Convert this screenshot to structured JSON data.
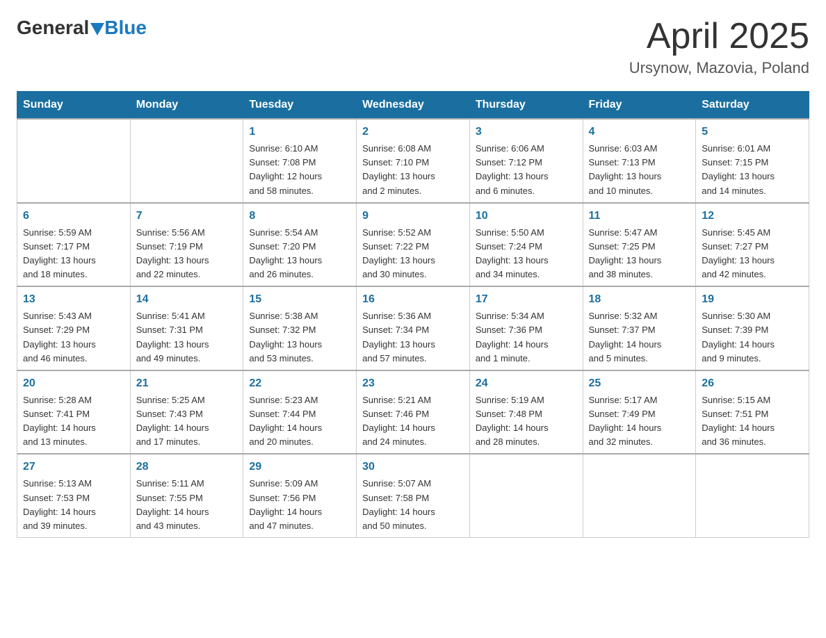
{
  "header": {
    "logo": {
      "general": "General",
      "blue": "Blue"
    },
    "title": "April 2025",
    "location": "Ursynow, Mazovia, Poland"
  },
  "weekdays": [
    "Sunday",
    "Monday",
    "Tuesday",
    "Wednesday",
    "Thursday",
    "Friday",
    "Saturday"
  ],
  "weeks": [
    [
      {
        "day": "",
        "info": ""
      },
      {
        "day": "",
        "info": ""
      },
      {
        "day": "1",
        "info": "Sunrise: 6:10 AM\nSunset: 7:08 PM\nDaylight: 12 hours\nand 58 minutes."
      },
      {
        "day": "2",
        "info": "Sunrise: 6:08 AM\nSunset: 7:10 PM\nDaylight: 13 hours\nand 2 minutes."
      },
      {
        "day": "3",
        "info": "Sunrise: 6:06 AM\nSunset: 7:12 PM\nDaylight: 13 hours\nand 6 minutes."
      },
      {
        "day": "4",
        "info": "Sunrise: 6:03 AM\nSunset: 7:13 PM\nDaylight: 13 hours\nand 10 minutes."
      },
      {
        "day": "5",
        "info": "Sunrise: 6:01 AM\nSunset: 7:15 PM\nDaylight: 13 hours\nand 14 minutes."
      }
    ],
    [
      {
        "day": "6",
        "info": "Sunrise: 5:59 AM\nSunset: 7:17 PM\nDaylight: 13 hours\nand 18 minutes."
      },
      {
        "day": "7",
        "info": "Sunrise: 5:56 AM\nSunset: 7:19 PM\nDaylight: 13 hours\nand 22 minutes."
      },
      {
        "day": "8",
        "info": "Sunrise: 5:54 AM\nSunset: 7:20 PM\nDaylight: 13 hours\nand 26 minutes."
      },
      {
        "day": "9",
        "info": "Sunrise: 5:52 AM\nSunset: 7:22 PM\nDaylight: 13 hours\nand 30 minutes."
      },
      {
        "day": "10",
        "info": "Sunrise: 5:50 AM\nSunset: 7:24 PM\nDaylight: 13 hours\nand 34 minutes."
      },
      {
        "day": "11",
        "info": "Sunrise: 5:47 AM\nSunset: 7:25 PM\nDaylight: 13 hours\nand 38 minutes."
      },
      {
        "day": "12",
        "info": "Sunrise: 5:45 AM\nSunset: 7:27 PM\nDaylight: 13 hours\nand 42 minutes."
      }
    ],
    [
      {
        "day": "13",
        "info": "Sunrise: 5:43 AM\nSunset: 7:29 PM\nDaylight: 13 hours\nand 46 minutes."
      },
      {
        "day": "14",
        "info": "Sunrise: 5:41 AM\nSunset: 7:31 PM\nDaylight: 13 hours\nand 49 minutes."
      },
      {
        "day": "15",
        "info": "Sunrise: 5:38 AM\nSunset: 7:32 PM\nDaylight: 13 hours\nand 53 minutes."
      },
      {
        "day": "16",
        "info": "Sunrise: 5:36 AM\nSunset: 7:34 PM\nDaylight: 13 hours\nand 57 minutes."
      },
      {
        "day": "17",
        "info": "Sunrise: 5:34 AM\nSunset: 7:36 PM\nDaylight: 14 hours\nand 1 minute."
      },
      {
        "day": "18",
        "info": "Sunrise: 5:32 AM\nSunset: 7:37 PM\nDaylight: 14 hours\nand 5 minutes."
      },
      {
        "day": "19",
        "info": "Sunrise: 5:30 AM\nSunset: 7:39 PM\nDaylight: 14 hours\nand 9 minutes."
      }
    ],
    [
      {
        "day": "20",
        "info": "Sunrise: 5:28 AM\nSunset: 7:41 PM\nDaylight: 14 hours\nand 13 minutes."
      },
      {
        "day": "21",
        "info": "Sunrise: 5:25 AM\nSunset: 7:43 PM\nDaylight: 14 hours\nand 17 minutes."
      },
      {
        "day": "22",
        "info": "Sunrise: 5:23 AM\nSunset: 7:44 PM\nDaylight: 14 hours\nand 20 minutes."
      },
      {
        "day": "23",
        "info": "Sunrise: 5:21 AM\nSunset: 7:46 PM\nDaylight: 14 hours\nand 24 minutes."
      },
      {
        "day": "24",
        "info": "Sunrise: 5:19 AM\nSunset: 7:48 PM\nDaylight: 14 hours\nand 28 minutes."
      },
      {
        "day": "25",
        "info": "Sunrise: 5:17 AM\nSunset: 7:49 PM\nDaylight: 14 hours\nand 32 minutes."
      },
      {
        "day": "26",
        "info": "Sunrise: 5:15 AM\nSunset: 7:51 PM\nDaylight: 14 hours\nand 36 minutes."
      }
    ],
    [
      {
        "day": "27",
        "info": "Sunrise: 5:13 AM\nSunset: 7:53 PM\nDaylight: 14 hours\nand 39 minutes."
      },
      {
        "day": "28",
        "info": "Sunrise: 5:11 AM\nSunset: 7:55 PM\nDaylight: 14 hours\nand 43 minutes."
      },
      {
        "day": "29",
        "info": "Sunrise: 5:09 AM\nSunset: 7:56 PM\nDaylight: 14 hours\nand 47 minutes."
      },
      {
        "day": "30",
        "info": "Sunrise: 5:07 AM\nSunset: 7:58 PM\nDaylight: 14 hours\nand 50 minutes."
      },
      {
        "day": "",
        "info": ""
      },
      {
        "day": "",
        "info": ""
      },
      {
        "day": "",
        "info": ""
      }
    ]
  ]
}
